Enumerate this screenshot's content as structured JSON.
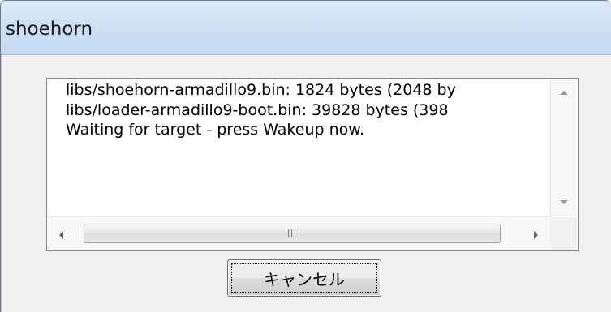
{
  "window": {
    "title": "shoehorn"
  },
  "log": {
    "lines": [
      "libs/shoehorn-armadillo9.bin: 1824 bytes (2048 by",
      "libs/loader-armadillo9-boot.bin: 39828 bytes (398",
      "Waiting for target - press Wakeup now."
    ]
  },
  "icons": {
    "scroll_up": "scroll-up-arrow-icon",
    "scroll_down": "scroll-down-arrow-icon",
    "scroll_left": "scroll-left-arrow-icon",
    "scroll_right": "scroll-right-arrow-icon",
    "thumb_grip": "grip-icon"
  },
  "buttons": {
    "cancel_label": "キャンセル"
  },
  "colors": {
    "titlebar": "#cfe2f4",
    "client_bg": "#f0f0f0"
  }
}
